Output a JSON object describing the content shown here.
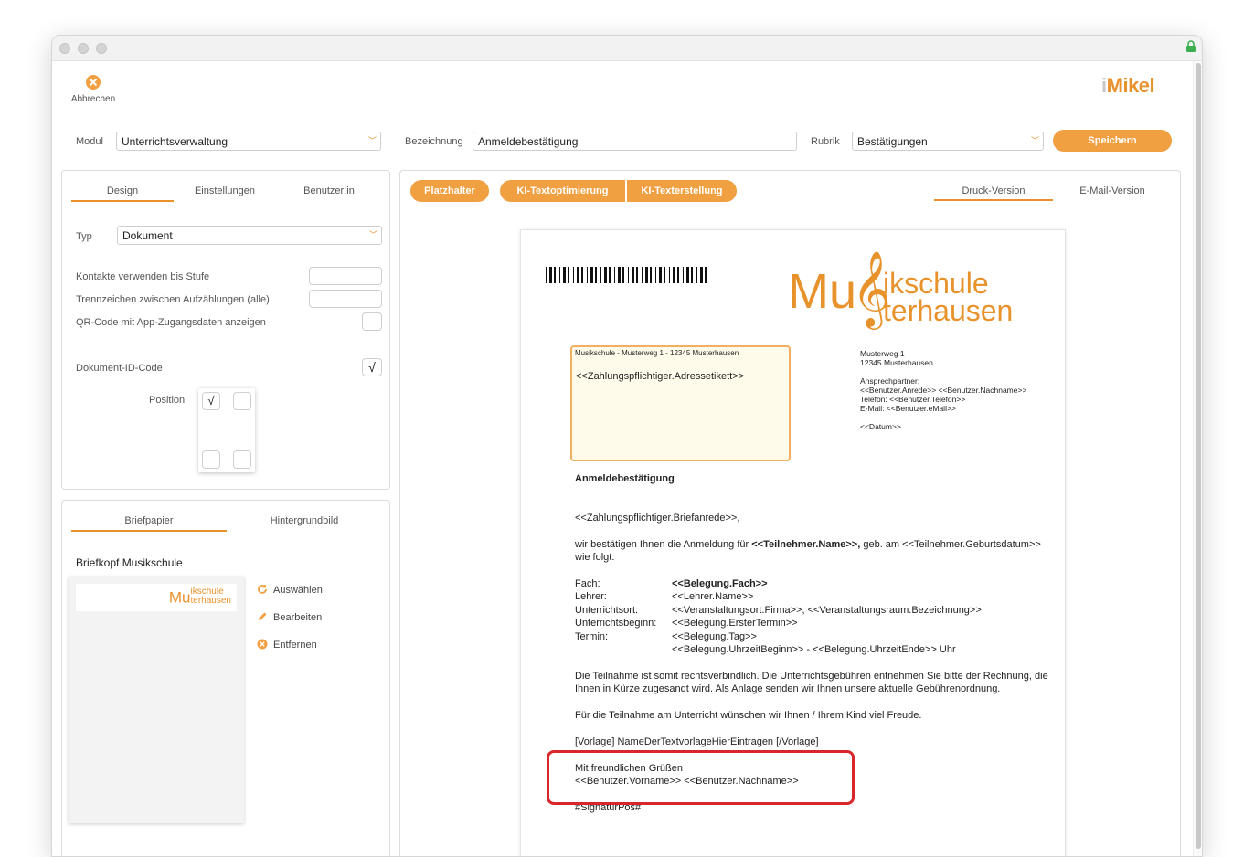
{
  "toolbar": {
    "cancel_label": "Abbrechen",
    "brand": "Mikel",
    "brand_prefix": "i"
  },
  "form": {
    "modul_label": "Modul",
    "modul_value": "Unterrichtsverwaltung",
    "bezeichnung_label": "Bezeichnung",
    "bezeichnung_value": "Anmeldebestätigung",
    "rubrik_label": "Rubrik",
    "rubrik_value": "Bestätigungen",
    "save_label": "Speichern"
  },
  "left_panel": {
    "tabs": [
      "Design",
      "Einstellungen",
      "Benutzer:in"
    ],
    "typ_label": "Typ",
    "typ_value": "Dokument",
    "kontakte_label": "Kontakte verwenden bis Stufe",
    "trennzeichen_label": "Trennzeichen zwischen Aufzählungen (alle)",
    "qr_label": "QR-Code mit App-Zugangsdaten anzeigen",
    "docid_label": "Dokument-ID-Code",
    "docid_check": "√",
    "position_label": "Position",
    "position_check": "√"
  },
  "letter_panel": {
    "tabs": [
      "Briefpapier",
      "Hintergrundbild"
    ],
    "title": "Briefkopf Musikschule",
    "thumb_logo_top": "ikschule",
    "thumb_logo_bot": "terhausen",
    "thumb_logo_mu": "Mu",
    "actions": [
      "Auswählen",
      "Bearbeiten",
      "Entfernen"
    ]
  },
  "editor": {
    "buttons": [
      "Platzhalter",
      "KI-Textoptimierung",
      "KI-Texterstellung"
    ],
    "version_tabs": [
      "Druck-Version",
      "E-Mail-Version"
    ]
  },
  "document": {
    "logo_mu": "Mu",
    "logo_top": "ikschule",
    "logo_bot": "terhausen",
    "sender_line": "Musikschule - Musterweg 1 - 12345 Musterhausen",
    "address_placeholder": "<<Zahlungspflichtiger.Adressetikett>>",
    "sender_block": [
      "Musterweg 1",
      "12345 Musterhausen",
      "",
      "Ansprechpartner:",
      "<<Benutzer.Anrede>> <<Benutzer.Nachname>>",
      "Telefon: <<Benutzer.Telefon>>",
      "E-Mail: <<Benutzer.eMail>>",
      "",
      "<<Datum>>"
    ],
    "subject": "Anmeldebestätigung",
    "salutation": "<<Zahlungspflichtiger.Briefanrede>>,",
    "intro_1": "wir bestätigen Ihnen die Anmeldung für ",
    "intro_bold": "<<Teilnehmer.Name>>,",
    "intro_2": "  geb. am <<Teilnehmer.Geburtsdatum>>",
    "intro_3": "wie folgt:",
    "details": [
      {
        "k": "Fach:",
        "v": "<<Belegung.Fach>>",
        "bold": true
      },
      {
        "k": "Lehrer:",
        "v": "<<Lehrer.Name>>",
        "bold": false
      },
      {
        "k": "Unterrichtsort:",
        "v": "<<Veranstaltungsort.Firma>>, <<Veranstaltungsraum.Bezeichnung>>",
        "bold": false
      },
      {
        "k": "Unterrichtsbeginn:",
        "v": "<<Belegung.ErsterTermin>>",
        "bold": false
      },
      {
        "k": "Termin:",
        "v": "<<Belegung.Tag>>",
        "bold": false
      },
      {
        "k": "",
        "v": "<<Belegung.UhrzeitBeginn>> - <<Belegung.UhrzeitEnde>> Uhr",
        "bold": false
      }
    ],
    "para_1": "Die Teilnahme ist somit rechtsverbindlich. Die Unterrichtsgebühren entnehmen Sie bitte der Rechnung, die",
    "para_2": "Ihnen in Kürze zugesandt wird. Als Anlage senden wir Ihnen unsere aktuelle Gebührenordnung.",
    "para_3": "Für die Teilnahme am Unterricht wünschen wir Ihnen / Ihrem Kind viel Freude.",
    "vorlage": "[Vorlage]  NameDerTextvorlageHierEintragen  [/Vorlage]",
    "closing": "Mit freundlichen Grüßen",
    "signer": "<<Benutzer.Vorname>> <<Benutzer.Nachname>>",
    "signature": "#SignaturPos#"
  }
}
